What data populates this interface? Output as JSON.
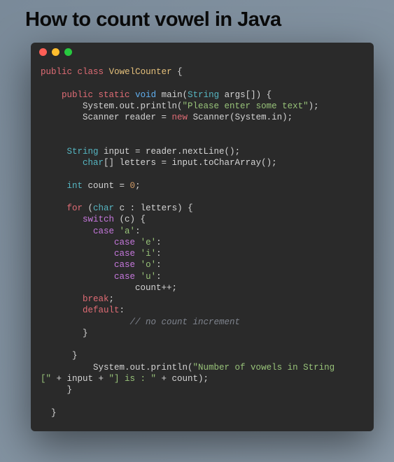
{
  "title": "How to count vowel in Java",
  "code": {
    "kw_public": "public",
    "kw_class": "class",
    "class_name": "VowelCounter",
    "kw_static": "static",
    "kw_void": "void",
    "fn_main": "main",
    "type_string": "String",
    "args_decl": "args[]) {",
    "sysout1": "System.out.println(",
    "str_prompt": "\"Please enter some text\"",
    "after_prompt": ");",
    "scanner_decl": "Scanner reader = ",
    "kw_new": "new",
    "scanner_ctor": " Scanner(System.in);",
    "input_decl": " input = reader.nextLine();",
    "kw_char": "char",
    "letters_decl": "[] letters = input.toCharArray();",
    "kw_int": "int",
    "count_decl": " count = ",
    "zero": "0",
    "semi": ";",
    "kw_for": "for",
    "for_open": " (",
    "for_var": " c : letters) {",
    "kw_switch": "switch",
    "switch_open": " (c) {",
    "kw_case": "case",
    "ch_a": "'a'",
    "ch_e": "'e'",
    "ch_i": "'i'",
    "ch_o": "'o'",
    "ch_u": "'u'",
    "colon": ":",
    "count_inc": "count++;",
    "kw_break": "break",
    "kw_default": "default",
    "comment_noinc": "// no count increment",
    "brace_close": "}",
    "sysout2": "System.out.println(",
    "str_result1": "\"Number of vowels in String ",
    "str_bracket1": "[\"",
    "plus_input": " + input + ",
    "str_result2": "\"] is : \"",
    "plus_count": " + count);"
  }
}
